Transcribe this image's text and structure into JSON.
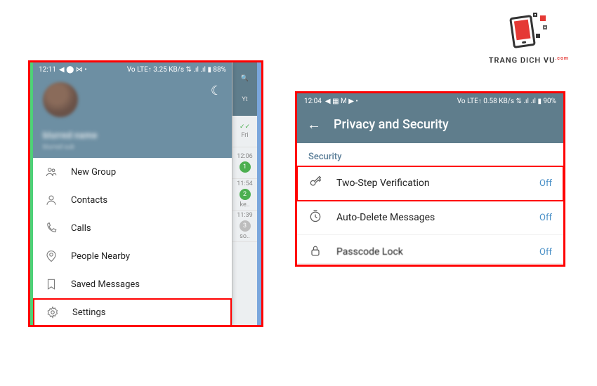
{
  "logo": {
    "text": "TRANG DICH VU",
    "dot": ".com"
  },
  "left": {
    "status": {
      "time": "12:11",
      "icons_left": "◀ ⬤ ⋈ •",
      "icons_right": "Vo LTE↑ 3.25 KB/s ⇅ .ıl .ıl ▮ 88%"
    },
    "profile": {
      "name": "blurred name",
      "sub": "blurred sub"
    },
    "menu": [
      {
        "key": "new-group",
        "label": "New Group"
      },
      {
        "key": "contacts",
        "label": "Contacts"
      },
      {
        "key": "calls",
        "label": "Calls"
      },
      {
        "key": "people-nearby",
        "label": "People Nearby"
      },
      {
        "key": "saved-messages",
        "label": "Saved Messages"
      },
      {
        "key": "settings",
        "label": "Settings"
      }
    ],
    "chatback": {
      "top_icons": [
        "🔍",
        "Yt"
      ],
      "rows": [
        {
          "time": "Fri",
          "badge": "",
          "check": "✓✓"
        },
        {
          "time": "12:06",
          "badge": "1"
        },
        {
          "time": "11:54",
          "badge": "2",
          "sub": "ke.."
        },
        {
          "time": "11:39",
          "badge": "3",
          "grey": true,
          "sub": "so.."
        }
      ]
    }
  },
  "right": {
    "status": {
      "time": "12:04",
      "icons_left": "◀ ▦ M ▶ •",
      "icons_right": "Vo LTE↑ 0.58 KB/s ⇅ .ıl .ıl ▮ 90%"
    },
    "title": "Privacy and Security",
    "section": "Security",
    "rows": [
      {
        "key": "two-step",
        "label": "Two-Step Verification",
        "val": "Off",
        "highlight": true
      },
      {
        "key": "auto-delete",
        "label": "Auto-Delete Messages",
        "val": "Off"
      },
      {
        "key": "passcode",
        "label": "Passcode Lock",
        "val": "Off",
        "cut": true
      }
    ]
  }
}
